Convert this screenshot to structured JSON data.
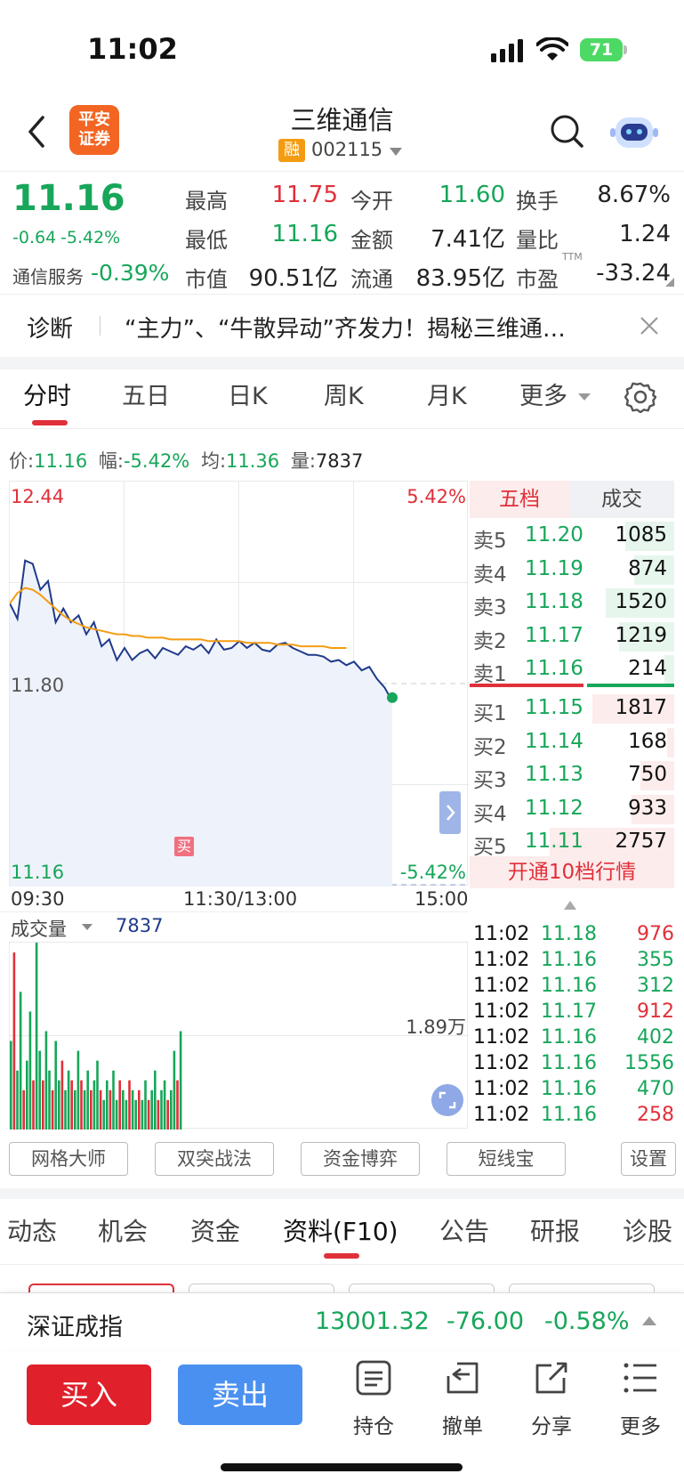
{
  "status_bar": {
    "time": "11:02",
    "battery": "71"
  },
  "header": {
    "logo_text_1": "平安",
    "logo_text_2": "证券",
    "name": "三维通信",
    "badge": "融",
    "code": "002115"
  },
  "quote": {
    "price": "11.16",
    "change": "-0.64",
    "change_pct": "-5.42%",
    "sector_label": "通信服务",
    "sector_pct": "-0.39%",
    "high_label": "最高",
    "high": "11.75",
    "open_label": "今开",
    "open": "11.60",
    "turnover_label": "换手",
    "turnover": "8.67%",
    "low_label": "最低",
    "low": "11.16",
    "amount_label": "金额",
    "amount": "7.41亿",
    "vol_ratio_label": "量比",
    "vol_ratio": "1.24",
    "mcap_label": "市值",
    "mcap": "90.51亿",
    "float_label": "流通",
    "float": "83.95亿",
    "pe_label": "市盈",
    "pe_sup": "TTM",
    "pe": "-33.24"
  },
  "diagnosis": {
    "label": "诊断",
    "text": "“主力”、“牛散异动”齐发力！揭秘三维通…"
  },
  "chart_tabs": [
    "分时",
    "五日",
    "日K",
    "周K",
    "月K",
    "更多"
  ],
  "info_line": {
    "price_label": "价:",
    "price": "11.16",
    "range_label": "幅:",
    "range": "-5.42%",
    "avg_label": "均:",
    "avg": "11.36",
    "vol_label": "量:",
    "vol": "7837"
  },
  "chart": {
    "y_top": "12.44",
    "y_mid": "11.80",
    "y_bottom": "11.16",
    "pct_top": "5.42%",
    "pct_bottom": "-5.42%",
    "x_start": "09:30",
    "x_mid": "11:30/13:00",
    "x_end": "15:00",
    "buy_marker": "买",
    "volume_label": "成交量",
    "volume_value": "7837",
    "volume_max": "1.89万"
  },
  "chart_data": {
    "type": "line",
    "title": "",
    "xlabel": "",
    "ylabel": "",
    "ylim": [
      10.08,
      12.44
    ],
    "x_range": [
      "09:30",
      "15:00"
    ],
    "series": [
      {
        "name": "价",
        "values": [
          11.73,
          11.64,
          11.98,
          11.96,
          11.81,
          11.86,
          11.62,
          11.7,
          11.62,
          11.66,
          11.55,
          11.62,
          11.48,
          11.52,
          11.4,
          11.47,
          11.4,
          11.44,
          11.46,
          11.41,
          11.47,
          11.45,
          11.43,
          11.48,
          11.46,
          11.49,
          11.44,
          11.52,
          11.46,
          11.47,
          11.51,
          11.47,
          11.5,
          11.46,
          11.45,
          11.49,
          11.5,
          11.47,
          11.45,
          11.43,
          11.43,
          11.42,
          11.39,
          11.4,
          11.37,
          11.39,
          11.34,
          11.36,
          11.29,
          11.24,
          11.16
        ]
      },
      {
        "name": "均",
        "values": [
          11.73,
          11.79,
          11.82,
          11.81,
          11.78,
          11.74,
          11.7,
          11.66,
          11.63,
          11.61,
          11.59,
          11.58,
          11.57,
          11.56,
          11.55,
          11.55,
          11.54,
          11.54,
          11.53,
          11.53,
          11.53,
          11.52,
          11.52,
          11.52,
          11.52,
          11.52,
          11.51,
          11.51,
          11.51,
          11.51,
          11.51,
          11.5,
          11.5,
          11.5,
          11.5,
          11.49,
          11.49,
          11.49,
          11.48,
          11.48,
          11.48,
          11.48,
          11.47,
          11.47,
          11.47
        ]
      }
    ],
    "volume": [
      9,
      18,
      6,
      14,
      4,
      7,
      12,
      5,
      19,
      8,
      5,
      10,
      6,
      4,
      9,
      5,
      7,
      4,
      6,
      5,
      4,
      8,
      5,
      4,
      6,
      4,
      5,
      7,
      4,
      3,
      5,
      4,
      6,
      3,
      5,
      4,
      3,
      5,
      4,
      3,
      4,
      3,
      5,
      3,
      4,
      6,
      3,
      4,
      5,
      3,
      4,
      8,
      5,
      10
    ],
    "volume_ylim": [
      0,
      19000
    ]
  },
  "order_book": {
    "tab_active": "五档",
    "tab_other": "成交",
    "asks": [
      {
        "label": "卖5",
        "price": "11.20",
        "vol": "1085",
        "weight": 0.39
      },
      {
        "label": "卖4",
        "price": "11.19",
        "vol": "874",
        "weight": 0.32
      },
      {
        "label": "卖3",
        "price": "11.18",
        "vol": "1520",
        "weight": 0.55
      },
      {
        "label": "卖2",
        "price": "11.17",
        "vol": "1219",
        "weight": 0.44
      },
      {
        "label": "卖1",
        "price": "11.16",
        "vol": "214",
        "weight": 0.08
      }
    ],
    "bids": [
      {
        "label": "买1",
        "price": "11.15",
        "vol": "1817",
        "weight": 0.66
      },
      {
        "label": "买2",
        "price": "11.14",
        "vol": "168",
        "weight": 0.06
      },
      {
        "label": "买3",
        "price": "11.13",
        "vol": "750",
        "weight": 0.27
      },
      {
        "label": "买4",
        "price": "11.12",
        "vol": "933",
        "weight": 0.34
      },
      {
        "label": "买5",
        "price": "11.11",
        "vol": "2757",
        "weight": 1.0
      }
    ],
    "upgrade": "开通10档行情"
  },
  "trades": [
    {
      "time": "11:02",
      "price": "11.18",
      "vol": "976",
      "dir": "up"
    },
    {
      "time": "11:02",
      "price": "11.16",
      "vol": "355",
      "dir": "down"
    },
    {
      "time": "11:02",
      "price": "11.16",
      "vol": "312",
      "dir": "down"
    },
    {
      "time": "11:02",
      "price": "11.17",
      "vol": "912",
      "dir": "up"
    },
    {
      "time": "11:02",
      "price": "11.16",
      "vol": "402",
      "dir": "down"
    },
    {
      "time": "11:02",
      "price": "11.16",
      "vol": "1556",
      "dir": "down"
    },
    {
      "time": "11:02",
      "price": "11.16",
      "vol": "470",
      "dir": "down"
    },
    {
      "time": "11:02",
      "price": "11.16",
      "vol": "258",
      "dir": "up"
    }
  ],
  "tools": [
    "网格大师",
    "双突战法",
    "资金博弈",
    "短线宝",
    "设置"
  ],
  "bottom_tabs": [
    "动态",
    "机会",
    "资金",
    "资料(F10)",
    "公告",
    "研报",
    "诊股"
  ],
  "index_bar": {
    "name": "深证成指",
    "value": "13001.32",
    "change": "-76.00",
    "pct": "-0.58%"
  },
  "actions": {
    "buy": "买入",
    "sell": "卖出",
    "holdings": "持仓",
    "cancel": "撤单",
    "share": "分享",
    "more": "更多"
  },
  "colors": {
    "up": "#e0303a",
    "down": "#17a65a",
    "avg_line": "#f39c12",
    "price_line": "#1f3a8a",
    "sell_btn": "#4a90f0"
  }
}
